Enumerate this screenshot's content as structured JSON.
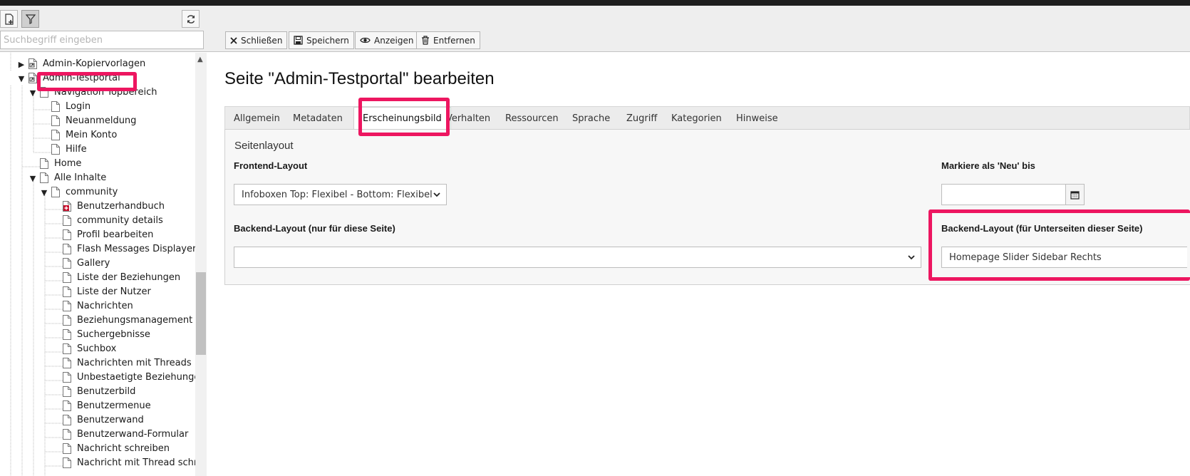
{
  "toolbar": {
    "search_placeholder": "Suchbegriff eingeben",
    "actions": [
      {
        "label": "Schließen",
        "icon": "close-icon"
      },
      {
        "label": "Speichern",
        "icon": "save-icon"
      },
      {
        "label": "Anzeigen",
        "icon": "view-icon"
      },
      {
        "label": "Entfernen",
        "icon": "delete-icon"
      }
    ]
  },
  "tree": {
    "items": [
      {
        "label": "Admin-Kopiervorlagen",
        "toggle": "▶",
        "icon": "page-shortcut-icon"
      },
      {
        "label": "Admin-Testportal",
        "toggle": "▼",
        "icon": "page-shortcut-icon",
        "selected": true
      },
      {
        "label": "Navigation Topbereich",
        "toggle": "▼",
        "icon": "page-icon"
      },
      {
        "label": "Login",
        "icon": "page-icon"
      },
      {
        "label": "Neuanmeldung",
        "icon": "page-icon"
      },
      {
        "label": "Mein Konto",
        "icon": "page-icon"
      },
      {
        "label": "Hilfe",
        "icon": "page-icon"
      },
      {
        "label": "Home",
        "icon": "page-icon"
      },
      {
        "label": "Alle Inhalte",
        "toggle": "▼",
        "icon": "page-icon"
      },
      {
        "label": "community",
        "toggle": "▼",
        "icon": "page-icon"
      },
      {
        "label": "Benutzerhandbuch",
        "icon": "page-plus-icon"
      },
      {
        "label": "community details",
        "icon": "page-icon"
      },
      {
        "label": "Profil bearbeiten",
        "icon": "page-icon"
      },
      {
        "label": "Flash Messages Displayer",
        "icon": "page-icon"
      },
      {
        "label": "Gallery",
        "icon": "page-icon"
      },
      {
        "label": "Liste der Beziehungen",
        "icon": "page-icon"
      },
      {
        "label": "Liste der Nutzer",
        "icon": "page-icon"
      },
      {
        "label": "Nachrichten",
        "icon": "page-icon"
      },
      {
        "label": "Beziehungsmanagement",
        "icon": "page-icon"
      },
      {
        "label": "Suchergebnisse",
        "icon": "page-icon"
      },
      {
        "label": "Suchbox",
        "icon": "page-icon"
      },
      {
        "label": "Nachrichten mit Threads",
        "icon": "page-icon"
      },
      {
        "label": "Unbestaetigte Beziehungen",
        "icon": "page-icon"
      },
      {
        "label": "Benutzerbild",
        "icon": "page-icon"
      },
      {
        "label": "Benutzermenue",
        "icon": "page-icon"
      },
      {
        "label": "Benutzerwand",
        "icon": "page-icon"
      },
      {
        "label": "Benutzerwand-Formular",
        "icon": "page-icon"
      },
      {
        "label": "Nachricht schreiben",
        "icon": "page-icon"
      },
      {
        "label": "Nachricht mit Thread schreiben",
        "icon": "page-icon"
      }
    ]
  },
  "main": {
    "title": "Seite \"Admin-Testportal\" bearbeiten",
    "tabs": [
      "Allgemein",
      "Metadaten",
      "Erscheinungsbild",
      "Verhalten",
      "Ressourcen",
      "Sprache",
      "Zugriff",
      "Kategorien",
      "Hinweise"
    ],
    "active_tab": "Erscheinungsbild",
    "section_title": "Seitenlayout",
    "frontend_layout": {
      "label": "Frontend-Layout",
      "value": "Infoboxen Top: Flexibel - Bottom: Flexibel"
    },
    "mark_new_until": {
      "label": "Markiere als 'Neu' bis",
      "value": ""
    },
    "backend_layout": {
      "label": "Backend-Layout (nur für diese Seite)",
      "value": ""
    },
    "backend_layout_sub": {
      "label": "Backend-Layout (für Unterseiten dieser Seite)",
      "value": "Homepage Slider Sidebar Rechts"
    }
  },
  "colors": {
    "highlight": "#ed1660",
    "header_bg": "#eeeeee"
  }
}
